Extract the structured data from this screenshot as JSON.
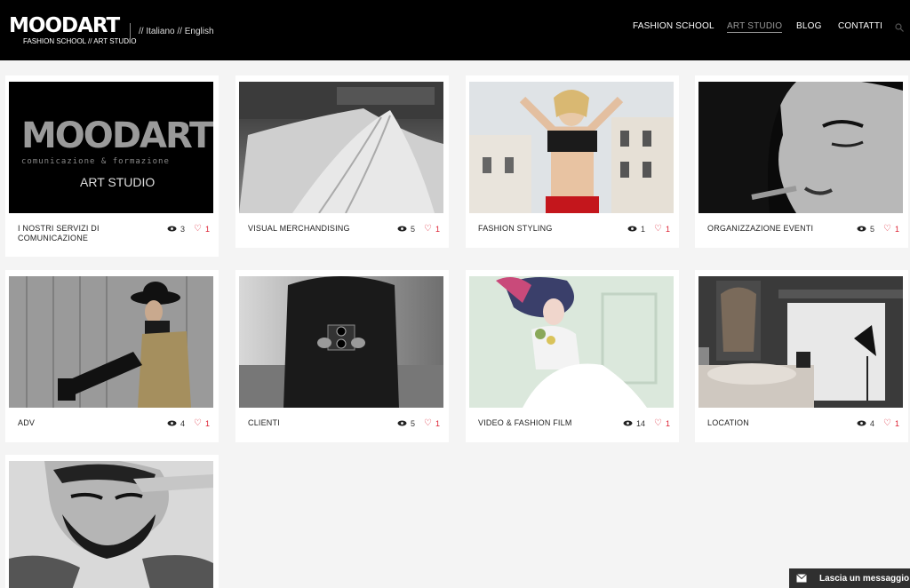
{
  "header": {
    "logo_main": "MOODART",
    "logo_sub": "FASHION SCHOOL // ART STUDIO",
    "lang_prefix": "//",
    "lang_it": "Italiano",
    "lang_sep": "//",
    "lang_en": "English",
    "nav": [
      "FASHION SCHOOL",
      "ART STUDIO",
      "BLOG",
      "CONTATTI"
    ],
    "active_nav": "ART STUDIO"
  },
  "cards": [
    {
      "title": "I NOSTRI SERVIZI DI COMUNICAZIONE",
      "views": "3",
      "likes": "1",
      "thumb_text": [
        "MOODART",
        "comunicazione & formazione",
        "ART STUDIO"
      ]
    },
    {
      "title": "VISUAL MERCHANDISING",
      "views": "5",
      "likes": "1"
    },
    {
      "title": "FASHION STYLING",
      "views": "1",
      "likes": "1"
    },
    {
      "title": "ORGANIZZAZIONE EVENTI",
      "views": "5",
      "likes": "1"
    },
    {
      "title": "ADV",
      "views": "4",
      "likes": "1"
    },
    {
      "title": "CLIENTI",
      "views": "5",
      "likes": "1"
    },
    {
      "title": "VIDEO & FASHION FILM",
      "views": "14",
      "likes": "1"
    },
    {
      "title": "LOCATION",
      "views": "4",
      "likes": "1"
    },
    {
      "title": "",
      "views": "",
      "likes": ""
    }
  ],
  "chat": {
    "label": "Lascia un messaggio"
  },
  "icons": {
    "view": "eye-icon",
    "like": "heart-icon",
    "search": "search-icon",
    "chat": "envelope-icon"
  },
  "colors": {
    "header_bg": "#000000",
    "page_bg": "#f4f4f4",
    "like": "#dd2233"
  }
}
